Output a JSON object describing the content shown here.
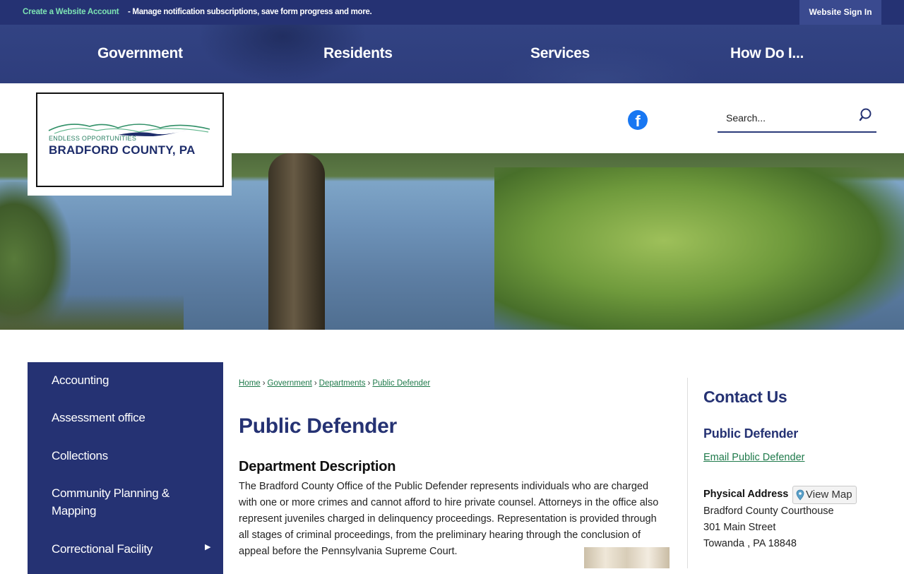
{
  "top_bar": {
    "create_account": "Create a Website Account",
    "manage_text": " - Manage notification subscriptions, save form progress and more.",
    "sign_in": "Website Sign In"
  },
  "main_nav": [
    "Government",
    "Residents",
    "Services",
    "How Do I..."
  ],
  "logo": {
    "tagline": "ENDLESS OPPORTUNITIES",
    "name": "BRADFORD COUNTY, PA"
  },
  "social": {
    "facebook_icon": "facebook-icon"
  },
  "search": {
    "placeholder": "Search...",
    "icon": "search-icon"
  },
  "sidebar": {
    "items": [
      "Accounting",
      "Assessment office",
      "Collections",
      "Community Planning & Mapping",
      "Correctional Facility"
    ]
  },
  "breadcrumb": [
    "Home",
    "Government",
    "Departments",
    "Public Defender"
  ],
  "page": {
    "title": "Public Defender",
    "section_heading": "Department Description",
    "description": "The Bradford County Office of the Public Defender represents individuals who are charged with one or more crimes and cannot afford to hire private counsel. Attorneys in the office also represent juveniles charged in delinquency proceedings. Representation is provided through all stages of criminal proceedings, from the preliminary hearing through the conclusion of appeal before the Pennsylvania Supreme Court."
  },
  "contact": {
    "heading": "Contact Us",
    "office": "Public Defender",
    "email_link": "Email Public Defender",
    "address_label": "Physical Address",
    "view_map": "View Map",
    "address_lines": [
      "Bradford County Courthouse",
      "301 Main Street",
      "Towanda , PA 18848"
    ]
  },
  "colors": {
    "brand_navy": "#253273",
    "link_green": "#1f7a4b",
    "accent_mint": "#7de3b3"
  }
}
